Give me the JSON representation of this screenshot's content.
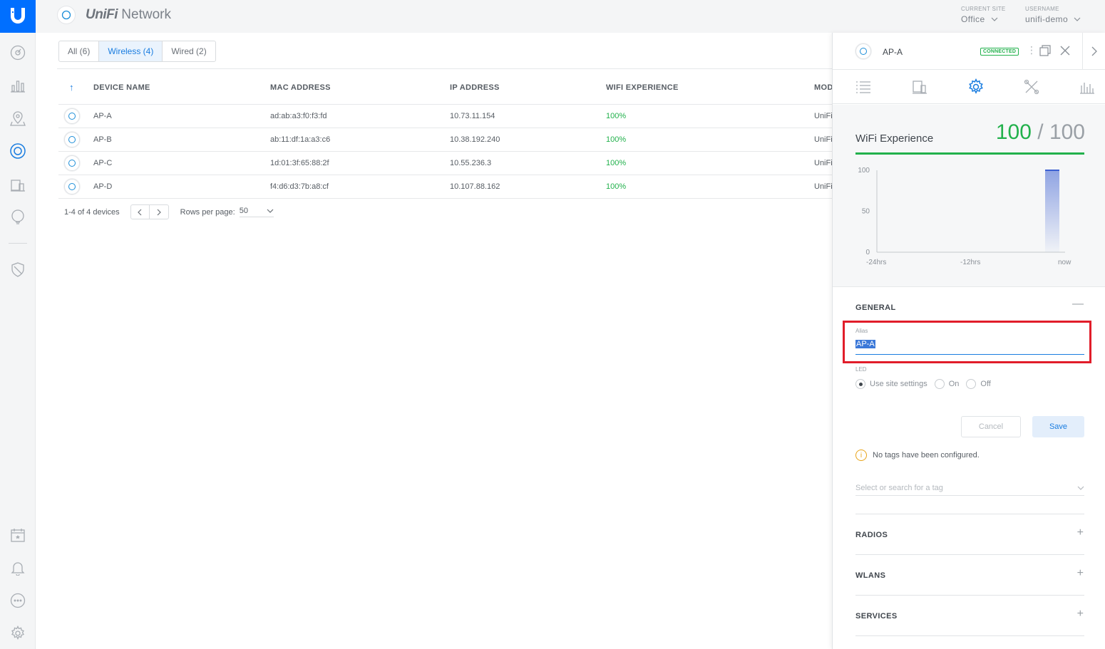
{
  "topbar": {
    "app_name_brand": "UniFi",
    "app_name_rest": "Network",
    "site": {
      "label": "CURRENT SITE",
      "value": "Office"
    },
    "user": {
      "label": "USERNAME",
      "value": "unifi-demo"
    }
  },
  "rail": {
    "icons": [
      "dashboard-icon",
      "statistics-icon",
      "map-icon",
      "devices-icon",
      "clients-icon",
      "insights-icon",
      "security-icon",
      "events-icon",
      "alerts-icon",
      "chat-icon",
      "settings-icon"
    ]
  },
  "filters": {
    "tabs": [
      {
        "label": "All (6)",
        "active": false
      },
      {
        "label": "Wireless (4)",
        "active": true
      },
      {
        "label": "Wired (2)",
        "active": false
      }
    ]
  },
  "table": {
    "sort_indicator": "↑",
    "columns": [
      "DEVICE NAME",
      "MAC ADDRESS",
      "IP ADDRESS",
      "WIFI EXPERIENCE",
      "MOD"
    ],
    "rows": [
      {
        "name": "AP-A",
        "mac": "ad:ab:a3:f0:f3:fd",
        "ip": "10.73.11.154",
        "wifi": "100%",
        "model": "UniFi"
      },
      {
        "name": "AP-B",
        "mac": "ab:11:df:1a:a3:c6",
        "ip": "10.38.192.240",
        "wifi": "100%",
        "model": "UniFi"
      },
      {
        "name": "AP-C",
        "mac": "1d:01:3f:65:88:2f",
        "ip": "10.55.236.3",
        "wifi": "100%",
        "model": "UniFi"
      },
      {
        "name": "AP-D",
        "mac": "f4:d6:d3:7b:a8:cf",
        "ip": "10.107.88.162",
        "wifi": "100%",
        "model": "UniFi"
      }
    ]
  },
  "pager": {
    "summary": "1-4 of 4 devices",
    "rows_label": "Rows per page:",
    "rows_value": "50"
  },
  "panel": {
    "title": "AP-A",
    "status_badge": "CONNECTED",
    "kebab": "⋮",
    "tab_icons": [
      "details-list-icon",
      "device-icon",
      "settings-gear-icon",
      "tools-icon",
      "stats-icon"
    ],
    "experience": {
      "label": "WiFi Experience",
      "score": "100",
      "separator": "/",
      "max": "100"
    },
    "general": {
      "heading": "GENERAL",
      "toggle": "—",
      "alias_label": "Alias",
      "alias_value": "AP-A",
      "led_label": "LED",
      "led_options": [
        {
          "label": "Use site settings",
          "selected": true
        },
        {
          "label": "On",
          "selected": false
        },
        {
          "label": "Off",
          "selected": false
        }
      ],
      "cancel_label": "Cancel",
      "save_label": "Save",
      "notice_icon": "i",
      "no_tags": "No tags have been configured.",
      "tag_placeholder": "Select or search for a tag"
    },
    "sections": [
      {
        "heading": "RADIOS",
        "toggle": "+"
      },
      {
        "heading": "WLANS",
        "toggle": "+"
      },
      {
        "heading": "SERVICES",
        "toggle": "+"
      }
    ]
  },
  "chart_data": {
    "type": "area",
    "title": "",
    "x_labels": [
      "-24hrs",
      "-12hrs",
      "now"
    ],
    "y_ticks": [
      0,
      50,
      100
    ],
    "ylim": [
      0,
      100
    ],
    "series": [
      {
        "values": [
          100
        ],
        "x": [
          "now"
        ]
      }
    ],
    "colors": {
      "fill": "#3b5fd1"
    }
  }
}
